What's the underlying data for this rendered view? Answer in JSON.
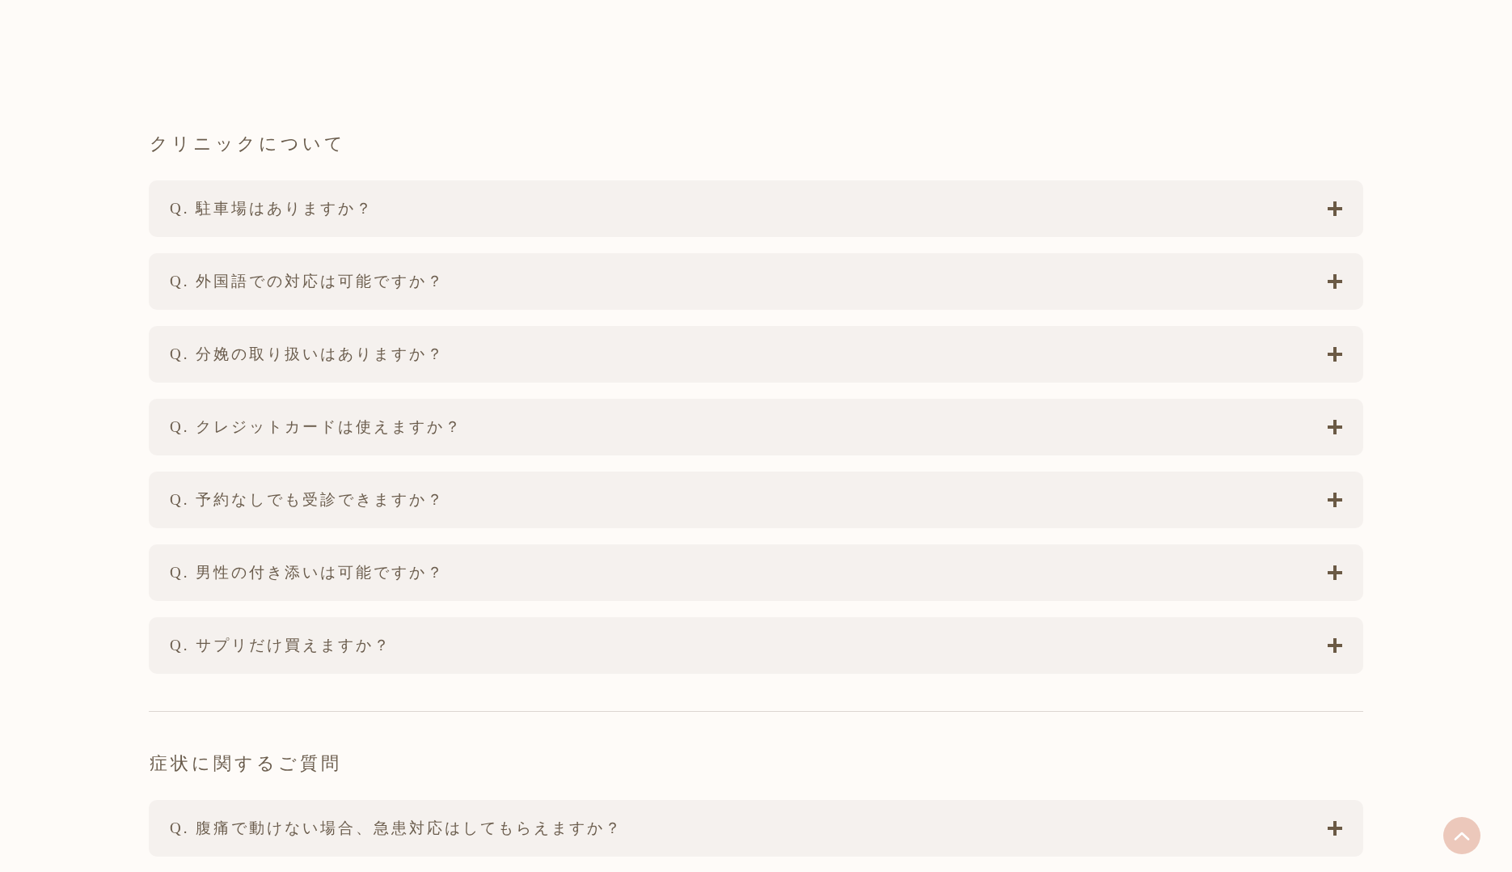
{
  "sections": [
    {
      "title": "クリニックについて",
      "items": [
        {
          "question": "Q. 駐車場はありますか？",
          "expanded": false
        },
        {
          "question": "Q. 外国語での対応は可能ですか？",
          "expanded": false
        },
        {
          "question": "Q. 分娩の取り扱いはありますか？",
          "expanded": false
        },
        {
          "question": "Q. クレジットカードは使えますか？",
          "expanded": false
        },
        {
          "question": "Q. 予約なしでも受診できますか？",
          "expanded": false
        },
        {
          "question": "Q. 男性の付き添いは可能ですか？",
          "expanded": false
        },
        {
          "question": "Q. サプリだけ買えますか？",
          "expanded": false
        }
      ]
    },
    {
      "title": "症状に関するご質問",
      "items": [
        {
          "question": "Q. 腹痛で動けない場合、急患対応はしてもらえますか？",
          "expanded": false
        }
      ]
    }
  ]
}
